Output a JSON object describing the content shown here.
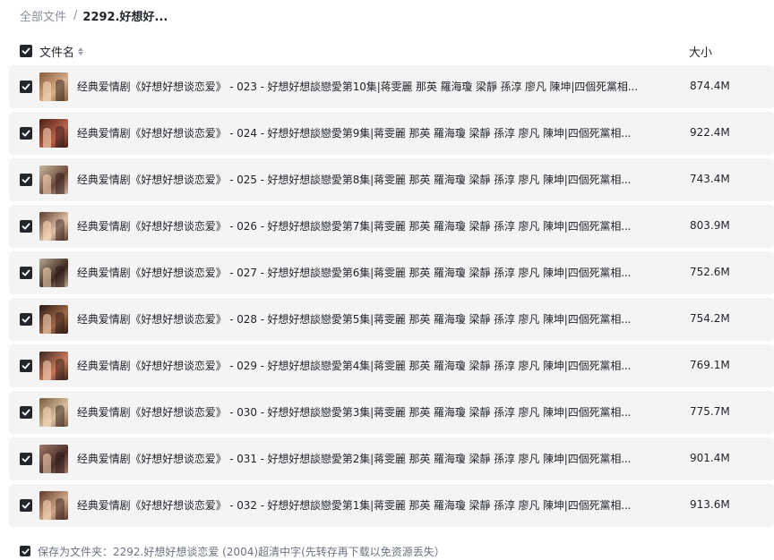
{
  "breadcrumb": {
    "root": "全部文件",
    "separator": "/",
    "current": "2292.好想好..."
  },
  "header": {
    "name_label": "文件名",
    "size_label": "大小",
    "sort_icon": "sort-icon"
  },
  "files": [
    {
      "name": "经典爱情剧《好想好想谈恋爱》 - 023 - 好想好想談戀愛第10集|蒋雯麗 那英 羅海瓊 梁靜 孫淳 廖凡 陳坤|四個死黨相...",
      "size": "874.4M",
      "thumb_colors": [
        "#8a5a3c",
        "#d8b08a"
      ]
    },
    {
      "name": "经典爱情剧《好想好想谈恋爱》 - 024 - 好想好想談戀愛第9集|蒋雯麗 那英 羅海瓊 梁靜 孫淳 廖凡 陳坤|四個死黨相...",
      "size": "922.4M",
      "thumb_colors": [
        "#4a1f18",
        "#b8624a"
      ]
    },
    {
      "name": "经典爱情剧《好想好想谈恋爱》 - 025 - 好想好想談戀愛第8集|蒋雯麗 那英 羅海瓊 梁靜 孫淳 廖凡 陳坤|四個死黨相...",
      "size": "743.4M",
      "thumb_colors": [
        "#c8b8a0",
        "#6d4a3a"
      ]
    },
    {
      "name": "经典爱情剧《好想好想谈恋爱》 - 026 - 好想好想談戀愛第7集|蒋雯麗 那英 羅海瓊 梁靜 孫淳 廖凡 陳坤|四個死黨相...",
      "size": "803.9M",
      "thumb_colors": [
        "#5a3a2e",
        "#e0c2a8"
      ]
    },
    {
      "name": "经典爱情剧《好想好想谈恋爱》 - 027 - 好想好想談戀愛第6集|蒋雯麗 那英 羅海瓊 梁靜 孫淳 廖凡 陳坤|四個死黨相...",
      "size": "752.6M",
      "thumb_colors": [
        "#b8a890",
        "#3e2a22"
      ]
    },
    {
      "name": "经典爱情剧《好想好想谈恋爱》 - 028 - 好想好想談戀愛第5集|蒋雯麗 那英 羅海瓊 梁靜 孫淳 廖凡 陳坤|四個死黨相...",
      "size": "754.2M",
      "thumb_colors": [
        "#2a1a16",
        "#a06848"
      ]
    },
    {
      "name": "经典爱情剧《好想好想谈恋爱》 - 029 - 好想好想談戀愛第4集|蒋雯麗 那英 羅海瓊 梁靜 孫淳 廖凡 陳坤|四個死黨相...",
      "size": "769.1M",
      "thumb_colors": [
        "#3a2420",
        "#c87a5a"
      ]
    },
    {
      "name": "经典爱情剧《好想好想谈恋爱》 - 030 - 好想好想談戀愛第3集|蒋雯麗 那英 羅海瓊 梁靜 孫淳 廖凡 陳坤|四個死黨相...",
      "size": "775.7M",
      "thumb_colors": [
        "#7a5a3e",
        "#d8c0a0"
      ]
    },
    {
      "name": "经典爱情剧《好想好想谈恋爱》 - 031 - 好想好想談戀愛第2集|蒋雯麗 那英 羅海瓊 梁靜 孫淳 廖凡 陳坤|四個死黨相...",
      "size": "901.4M",
      "thumb_colors": [
        "#a07a6a",
        "#4a2e2a"
      ]
    },
    {
      "name": "经典爱情剧《好想好想谈恋爱》 - 032 - 好想好想談戀愛第1集|蒋雯麗 那英 羅海瓊 梁靜 孫淳 廖凡 陳坤|四個死黨相...",
      "size": "913.6M",
      "thumb_colors": [
        "#5e3a2c",
        "#d0a888"
      ]
    }
  ],
  "footer": {
    "text": "保存为文件夹：2292.好想好想谈恋爱 (2004)超清中字(先转存再下载以免资源丢失）"
  },
  "colors": {
    "checkbox": "#23262b",
    "row_bg": "#f4f4f5",
    "muted_text": "#8a8f99"
  }
}
